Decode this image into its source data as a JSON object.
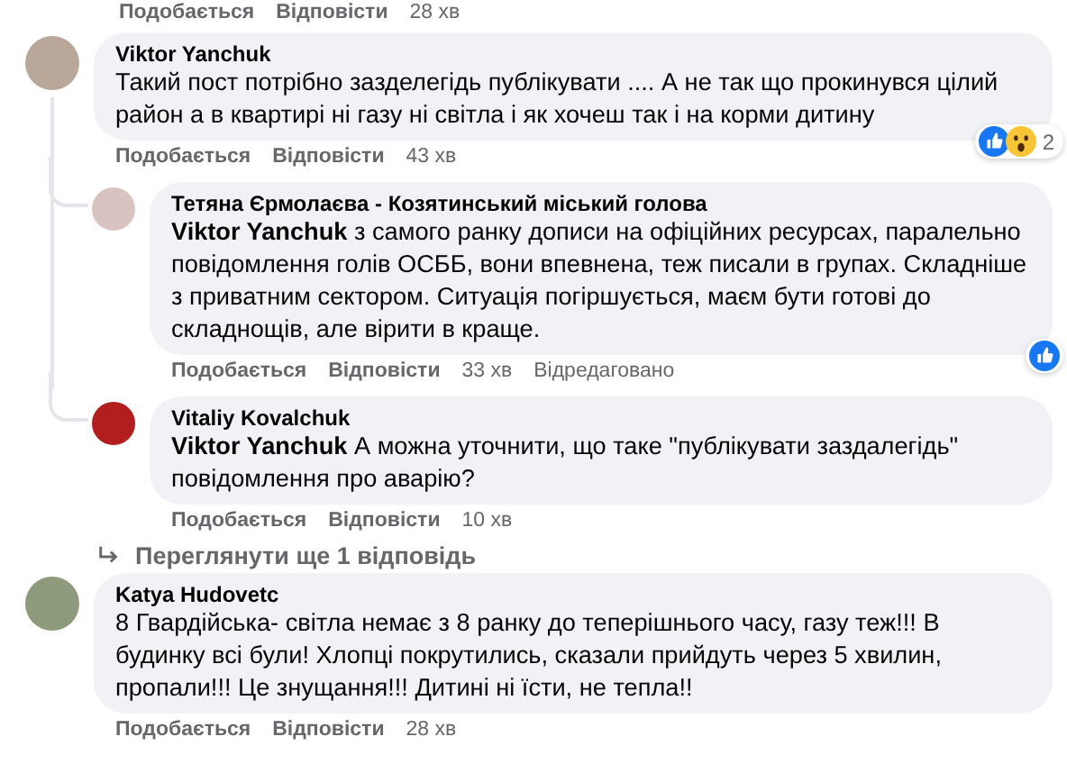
{
  "top_actions": {
    "like": "Подобається",
    "reply": "Відповісти",
    "time": "28 хв"
  },
  "comments": [
    {
      "author": "Viktor Yanchuk",
      "text": "Такий пост потрібно зазделегідь публікувати .... А не так що прокинувся цілий район а в квартирі ні газу ні світла і як хочеш так і на корми дитину",
      "actions": {
        "like": "Подобається",
        "reply": "Відповісти",
        "time": "43 хв"
      },
      "reactions": [
        {
          "kind": "like"
        },
        {
          "kind": "wow"
        }
      ],
      "reaction_count": "2",
      "replies": [
        {
          "author": "Тетяна Єрмолаєва - Козятинський міський голова",
          "mention": "Viktor Yanchuk",
          "text": "з самого ранку дописи на офіційних ресурсах, паралельно повідомлення голів ОСББ, вони впевнена, теж писали в групах. Складніше з приватним сектором. Ситуація погіршується, маєм бути готові до складнощів, але вірити в краще.",
          "actions": {
            "like": "Подобається",
            "reply": "Відповісти",
            "time": "33 хв",
            "edited": "Відредаговано"
          },
          "reactions": [
            {
              "kind": "like"
            }
          ]
        },
        {
          "author": "Vitaliy Kovalchuk",
          "mention": "Viktor Yanchuk",
          "text": "А можна уточнити, що таке \"публікувати заздалегідь\" повідомлення про аварію?",
          "actions": {
            "like": "Подобається",
            "reply": "Відповісти",
            "time": "10 хв"
          }
        }
      ],
      "more_replies": "Переглянути ще 1 відповідь"
    },
    {
      "author": "Katya Hudovetc",
      "text": "8 Гвардійська- світла немає з 8 ранку до теперішнього часу, газу теж!!! В будинку всі були! Хлопці покрутились, сказали прийдуть через 5 хвилин, пропали!!! Це знущання!!! Дитині ні їсти, не тепла!!",
      "actions": {
        "like": "Подобається",
        "reply": "Відповісти",
        "time": "28 хв"
      }
    }
  ]
}
